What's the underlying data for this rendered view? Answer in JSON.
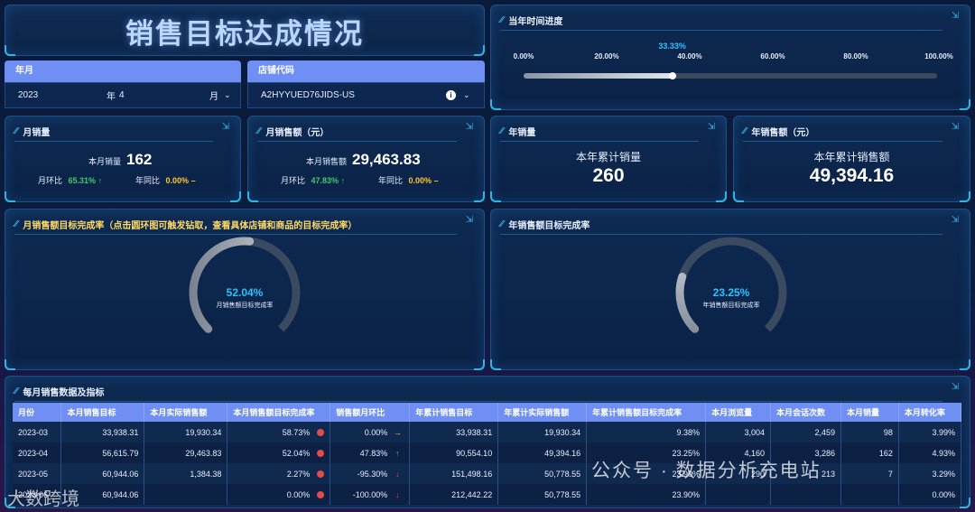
{
  "header": {
    "title": "销售目标达成情况"
  },
  "filters": {
    "period": {
      "label": "年月",
      "year": "2023",
      "year_unit": "年",
      "month": "4",
      "month_unit": "月"
    },
    "store": {
      "label": "店铺代码",
      "value": "A2HYYUED76JIDS-US"
    }
  },
  "time_progress": {
    "title": "当年时间进度",
    "current_label": "33.33%",
    "current_fraction": 0.3333,
    "ticks": [
      "0.00%",
      "20.00%",
      "40.00%",
      "60.00%",
      "80.00%",
      "100.00%"
    ]
  },
  "monthly_sales": {
    "title": "月销量",
    "current_label": "本月销量",
    "current_value": "162",
    "mom_label": "月环比",
    "mom_value": "65.31%",
    "mom_arrow": "↑",
    "yoy_label": "年同比",
    "yoy_value": "0.00%",
    "yoy_arrow": "–"
  },
  "monthly_revenue": {
    "title": "月销售额（元）",
    "current_label": "本月销售额",
    "current_value": "29,463.83",
    "mom_label": "月环比",
    "mom_value": "47.83%",
    "mom_arrow": "↑",
    "yoy_label": "年同比",
    "yoy_value": "0.00%",
    "yoy_arrow": "–"
  },
  "yearly_sales": {
    "title": "年销量",
    "label": "本年累计销量",
    "value": "260"
  },
  "yearly_revenue": {
    "title": "年销售额（元）",
    "label": "本年累计销售额",
    "value": "49,394.16"
  },
  "monthly_gauge": {
    "title": "月销售额目标完成率（点击圆环图可触发钻取，查看具体店铺和商品的目标完成率）",
    "pct_label": "52.04%",
    "fraction": 0.5204,
    "sub_label": "月销售额目标完成率"
  },
  "yearly_gauge": {
    "title": "年销售额目标完成率",
    "pct_label": "23.25%",
    "fraction": 0.2325,
    "sub_label": "年销售额目标完成率"
  },
  "table": {
    "title": "每月销售数据及指标",
    "columns": [
      "月份",
      "本月销售目标",
      "本月实际销售额",
      "本月销售额目标完成率",
      "销售额月环比",
      "年累计销售目标",
      "年累计实际销售额",
      "年累计销售额目标完成率",
      "本月浏览量",
      "本月会话次数",
      "本月销量",
      "本月转化率"
    ],
    "rows": [
      [
        "2023-03",
        "33,938.31",
        "19,930.34",
        "58.73%",
        "0.00%",
        "33,938.31",
        "19,930.34",
        "9.38%",
        "3,004",
        "2,459",
        "98",
        "3.99%"
      ],
      [
        "2023-04",
        "56,615.79",
        "29,463.83",
        "52.04%",
        "47.83%",
        "90,554.10",
        "49,394.16",
        "23.25%",
        "4,160",
        "3,286",
        "162",
        "4.93%"
      ],
      [
        "2023-05",
        "60,944.06",
        "1,384.38",
        "2.27%",
        "-95.30%",
        "151,498.16",
        "50,778.55",
        "23.90%",
        "290",
        "213",
        "7",
        "3.29%"
      ],
      [
        "2023-06",
        "60,944.06",
        "",
        "0.00%",
        "-100.00%",
        "212,442.22",
        "50,778.55",
        "23.90%",
        "",
        "",
        "",
        "0.00%"
      ]
    ],
    "arrows": [
      "→",
      "↑",
      "↓",
      "↓"
    ],
    "arrow_colors": [
      "#ffc62b",
      "#3dcb6a",
      "#e24b4b",
      "#e24b4b"
    ]
  },
  "watermark": {
    "text": "公众号 · 数据分析充电站",
    "text2": "大数跨境"
  },
  "colors": {
    "accent": "#2bc3ff",
    "header_bg": "#6f8ff5",
    "positive": "#3dcb6a",
    "neutral": "#ffc62b",
    "negative": "#e24b4b"
  }
}
